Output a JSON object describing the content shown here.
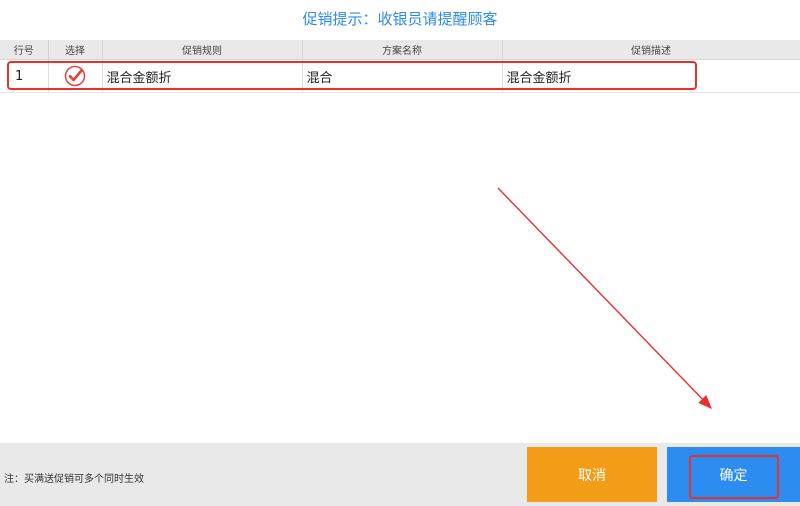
{
  "dialog": {
    "title": "促销提示：收银员请提醒顾客"
  },
  "table": {
    "columns": [
      "行号",
      "选择",
      "促销规则",
      "方案名称",
      "促销描述"
    ],
    "rows": [
      {
        "row_no": "1",
        "selected": true,
        "rule": "混合金额折",
        "plan_name": "混合",
        "description": "混合金额折"
      }
    ]
  },
  "footer": {
    "note": "注：买满送促销可多个同时生效",
    "cancel_label": "取消",
    "confirm_label": "确定"
  },
  "colors": {
    "title": "#2f8be6",
    "cancel": "#f39c18",
    "confirm": "#2d8cf0",
    "annotation": "#e8302c",
    "check": "#e0443c"
  },
  "icons": {
    "check": "check-circle-icon"
  }
}
